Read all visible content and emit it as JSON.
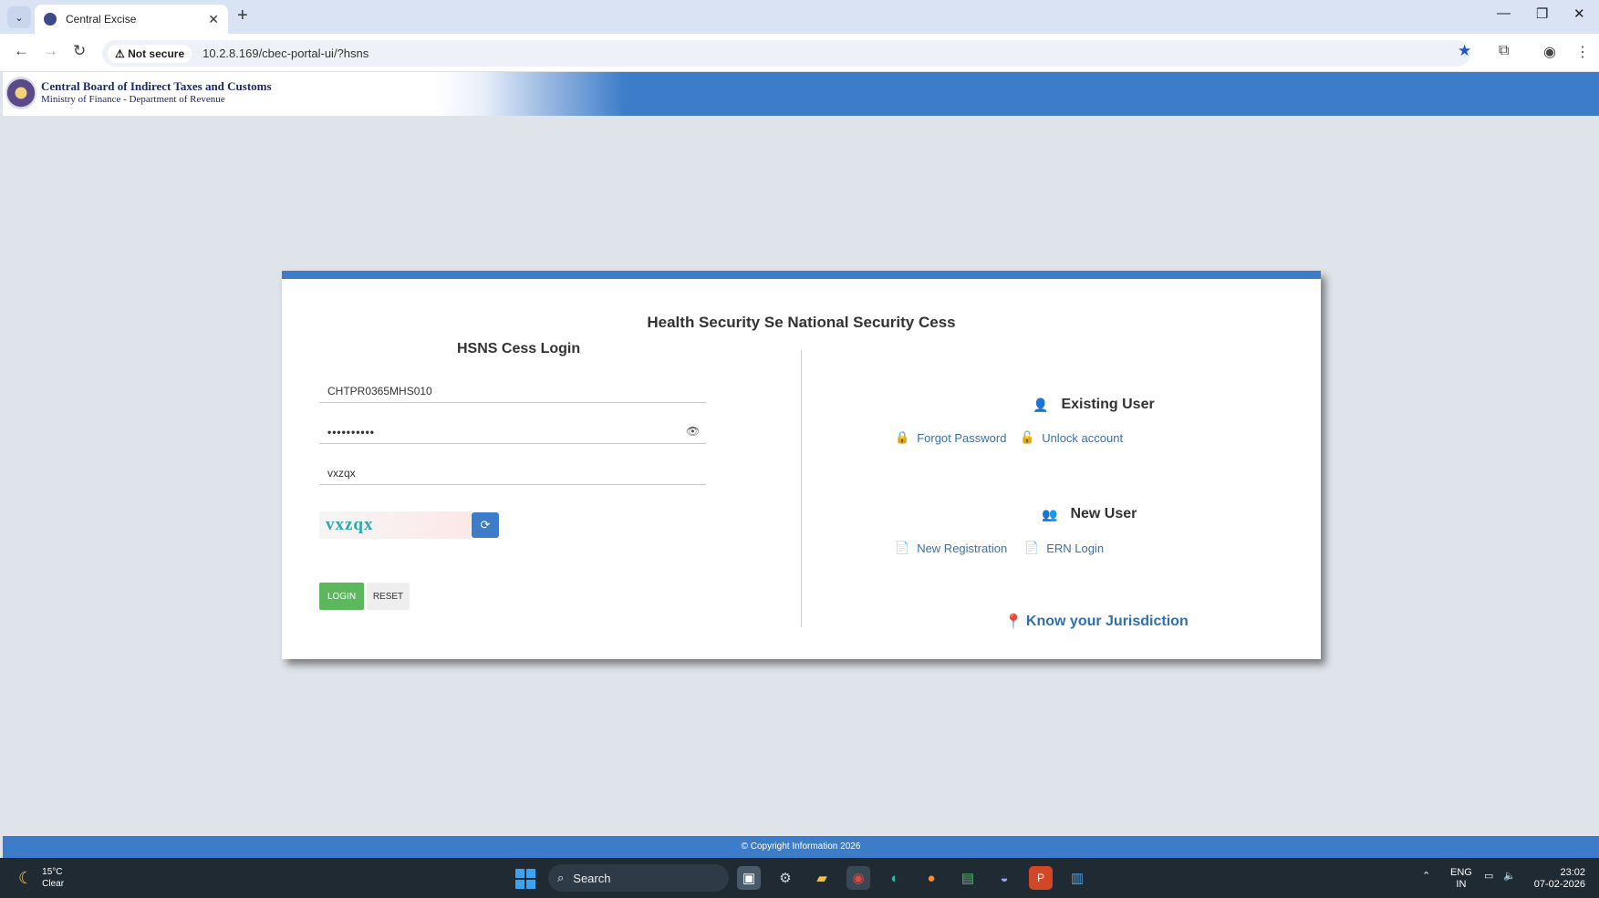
{
  "browser": {
    "tab_title": "Central Excise",
    "tab_close": "✕",
    "new_tab": "+",
    "security_label": "Not secure",
    "url": "10.2.8.169/cbec-portal-ui/?hsns",
    "window_controls": [
      "—",
      "❐",
      "✕"
    ]
  },
  "header": {
    "org_name": "Central Board of Indirect Taxes and Customs",
    "org_subtitle": "Ministry of Finance - Department of Revenue"
  },
  "card": {
    "title": "Health Security Se National Security Cess",
    "login_title": "HSNS Cess Login",
    "username_value": "CHTPR0365MHS010",
    "password_value": "••••••••••",
    "captcha_input_value": "vxzqx",
    "captcha_text": "vxzqx",
    "login_label": "LOGIN",
    "reset_label": "RESET",
    "existing_user": {
      "heading": "Existing User",
      "links": [
        "Forgot Password",
        "Unlock account"
      ]
    },
    "new_user": {
      "heading": "New User",
      "links": [
        "New Registration",
        "ERN Login"
      ]
    },
    "jurisdiction": "Know your Jurisdiction"
  },
  "footer": {
    "copyright": "© Copyright Information 2026"
  },
  "taskbar": {
    "weather_temp": "15°C",
    "weather_desc": "Clear",
    "search_label": "Search",
    "lang_top": "ENG",
    "lang_bottom": "IN",
    "time": "23:02",
    "date": "07-02-2026"
  },
  "colors": {
    "accent": "#3d7cc9",
    "login_button": "#5cb85c",
    "link": "#3c6fa5",
    "link_icon": "#e59b2c"
  }
}
